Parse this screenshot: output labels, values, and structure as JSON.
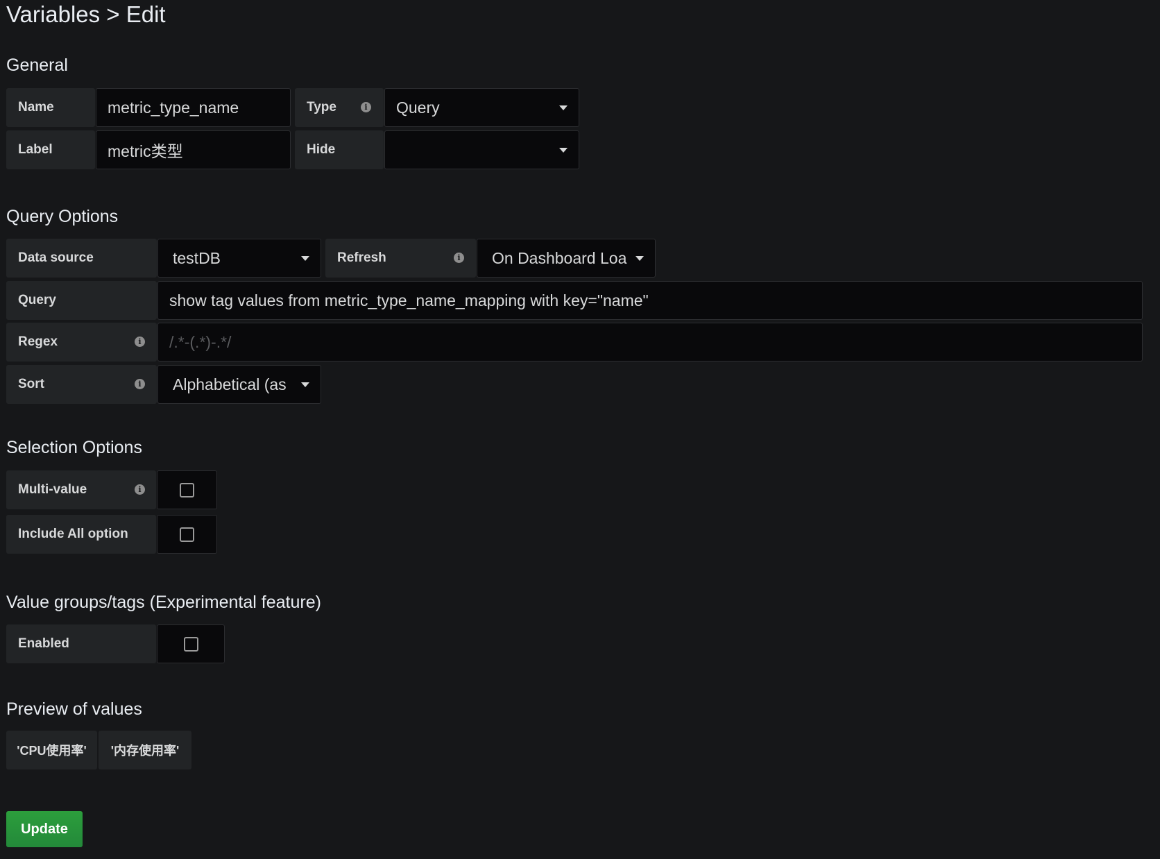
{
  "page": {
    "title": "Variables > Edit"
  },
  "general": {
    "section_title": "General",
    "name_label": "Name",
    "name_value": "metric_type_name",
    "type_label": "Type",
    "type_value": "Query",
    "label_label": "Label",
    "label_value": "metric类型",
    "hide_label": "Hide",
    "hide_value": ""
  },
  "query_options": {
    "section_title": "Query Options",
    "datasource_label": "Data source",
    "datasource_value": "testDB",
    "refresh_label": "Refresh",
    "refresh_value": "On Dashboard Loa",
    "query_label": "Query",
    "query_value": "show tag values from metric_type_name_mapping with key=\"name\"",
    "regex_label": "Regex",
    "regex_placeholder": "/.*-(.*)-.*/",
    "sort_label": "Sort",
    "sort_value": "Alphabetical (as"
  },
  "selection_options": {
    "section_title": "Selection Options",
    "multi_value_label": "Multi-value",
    "multi_value_checked": false,
    "include_all_label": "Include All option",
    "include_all_checked": false
  },
  "value_groups": {
    "section_title": "Value groups/tags (Experimental feature)",
    "enabled_label": "Enabled",
    "enabled_checked": false
  },
  "preview": {
    "section_title": "Preview of values",
    "values": [
      "'CPU使用率'",
      "'内存使用率'"
    ]
  },
  "actions": {
    "update_label": "Update"
  },
  "icons": {
    "info": "info-icon",
    "dropdown": "caret-down-icon",
    "checkbox": "checkbox-unchecked-icon"
  },
  "colors": {
    "background": "#161719",
    "label_bg": "#222426",
    "input_bg": "#09090b",
    "update_button": "#299c46"
  }
}
